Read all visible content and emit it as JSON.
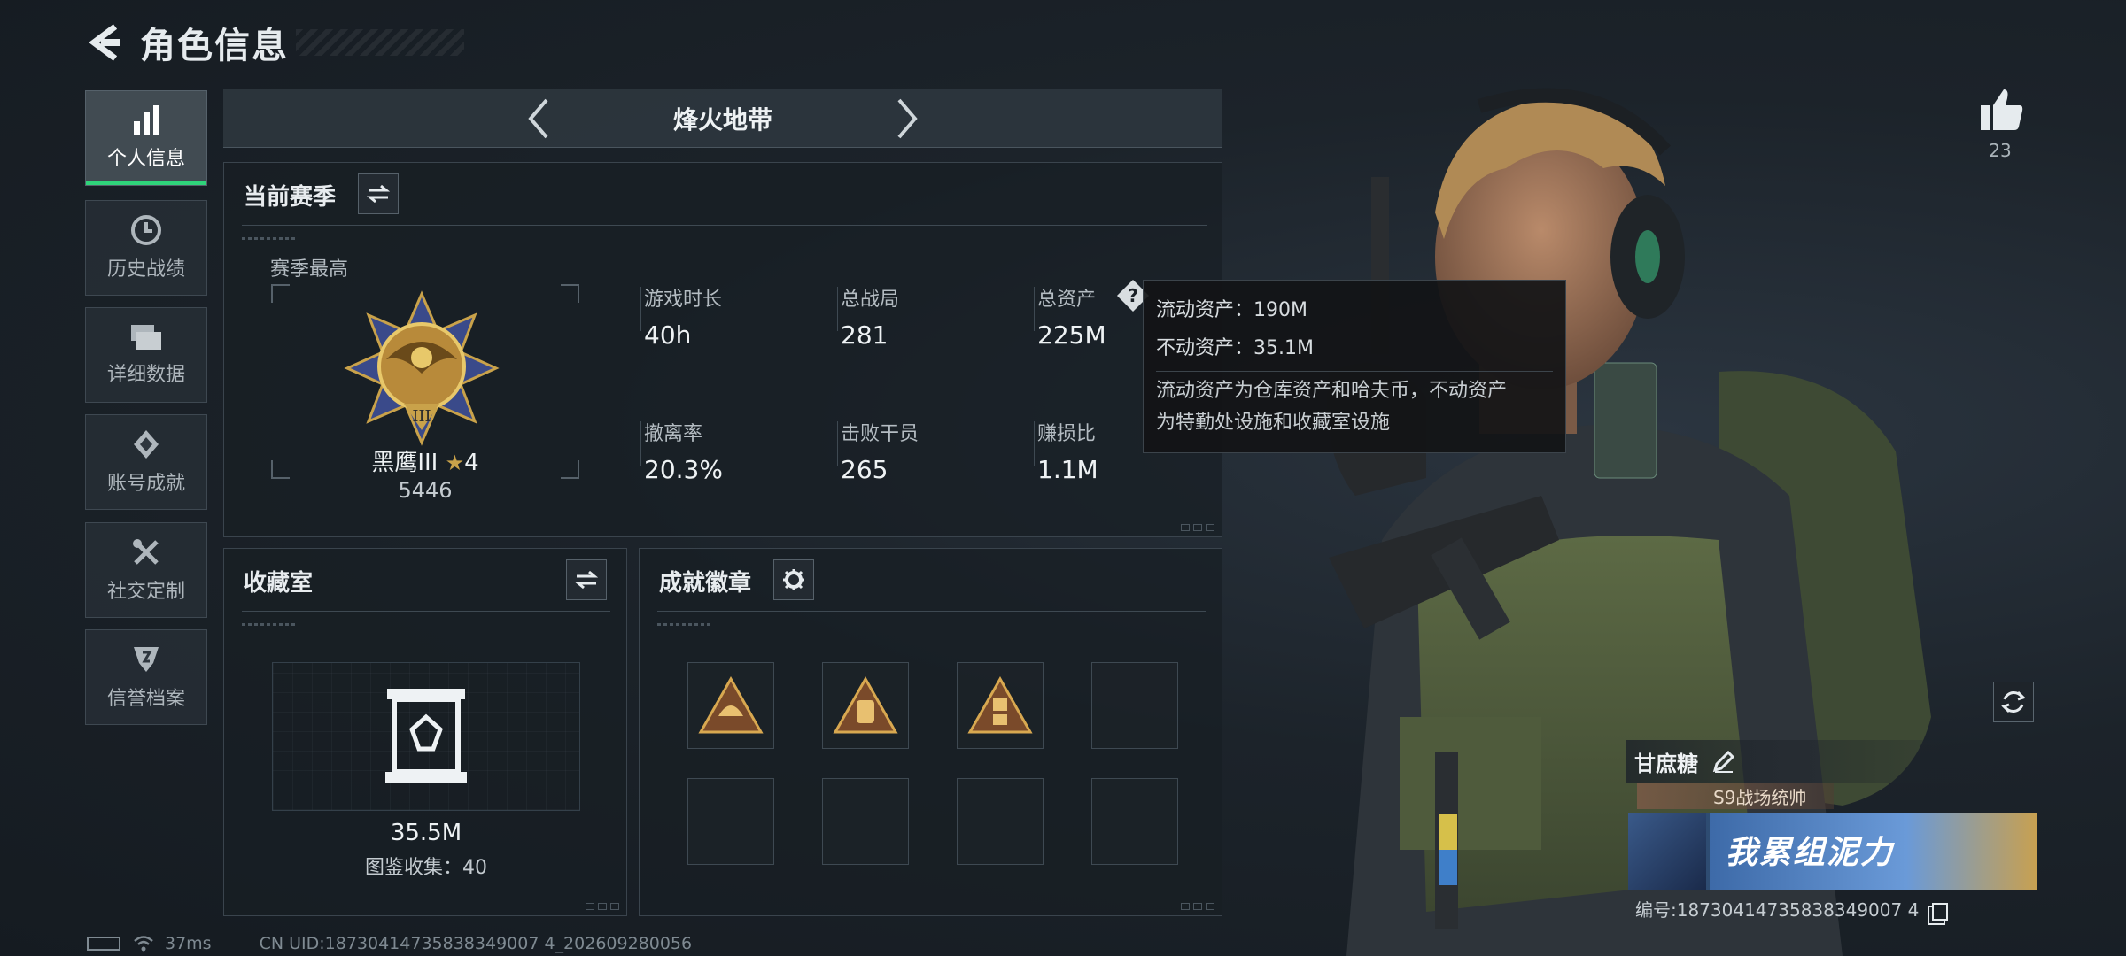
{
  "header": {
    "title": "角色信息"
  },
  "sidebar": {
    "items": [
      {
        "label": "个人信息",
        "active": true,
        "icon": "bar-chart-icon"
      },
      {
        "label": "历史战绩",
        "active": false,
        "icon": "clock-icon"
      },
      {
        "label": "详细数据",
        "active": false,
        "icon": "folder-icon"
      },
      {
        "label": "账号成就",
        "active": false,
        "icon": "diamond-medal-icon"
      },
      {
        "label": "社交定制",
        "active": false,
        "icon": "tools-icon"
      },
      {
        "label": "信誉档案",
        "active": false,
        "icon": "shield-badge-icon"
      }
    ]
  },
  "mode": {
    "label": "烽火地带"
  },
  "season": {
    "title": "当前赛季",
    "peak_label": "赛季最高",
    "rank_name": "黑鹰III",
    "rank_stars": "4",
    "rank_points": "5446",
    "stats": [
      {
        "label": "游戏时长",
        "value": "40h"
      },
      {
        "label": "总战局",
        "value": "281"
      },
      {
        "label": "总资产",
        "value": "225M"
      },
      {
        "label": "撤离率",
        "value": "20.3%"
      },
      {
        "label": "击败干员",
        "value": "265"
      },
      {
        "label": "赚损比",
        "value": "1.1M"
      }
    ]
  },
  "tooltip": {
    "liquid": "流动资产：190M",
    "fixed": "不动资产：35.1M",
    "desc_line1": "流动资产为仓库资产和哈夫币，不动资产",
    "desc_line2": "为特勤处设施和收藏室设施"
  },
  "collection": {
    "title": "收藏室",
    "value": "35.5M",
    "count_label": "图鉴收集：40"
  },
  "badges": {
    "title": "成就徽章",
    "slots": [
      {
        "filled": true,
        "icon": "helmet-badge-icon"
      },
      {
        "filled": true,
        "icon": "backpack-badge-icon"
      },
      {
        "filled": true,
        "icon": "ammo-badge-icon"
      },
      {
        "filled": false,
        "icon": ""
      },
      {
        "filled": false,
        "icon": ""
      },
      {
        "filled": false,
        "icon": ""
      },
      {
        "filled": false,
        "icon": ""
      },
      {
        "filled": false,
        "icon": ""
      }
    ]
  },
  "profile": {
    "likes": "23",
    "name": "甘庶糖",
    "title_tag": "S9战场统帅",
    "banner_text": "我累组泥力",
    "id_label": "编号:18730414735838349007 4"
  },
  "status_bar": {
    "ping": "37ms",
    "uid": "CN UID:18730414735838349007 4_202609280056"
  },
  "colors": {
    "accent_green": "#2fd47a",
    "gold": "#c9a24a"
  }
}
